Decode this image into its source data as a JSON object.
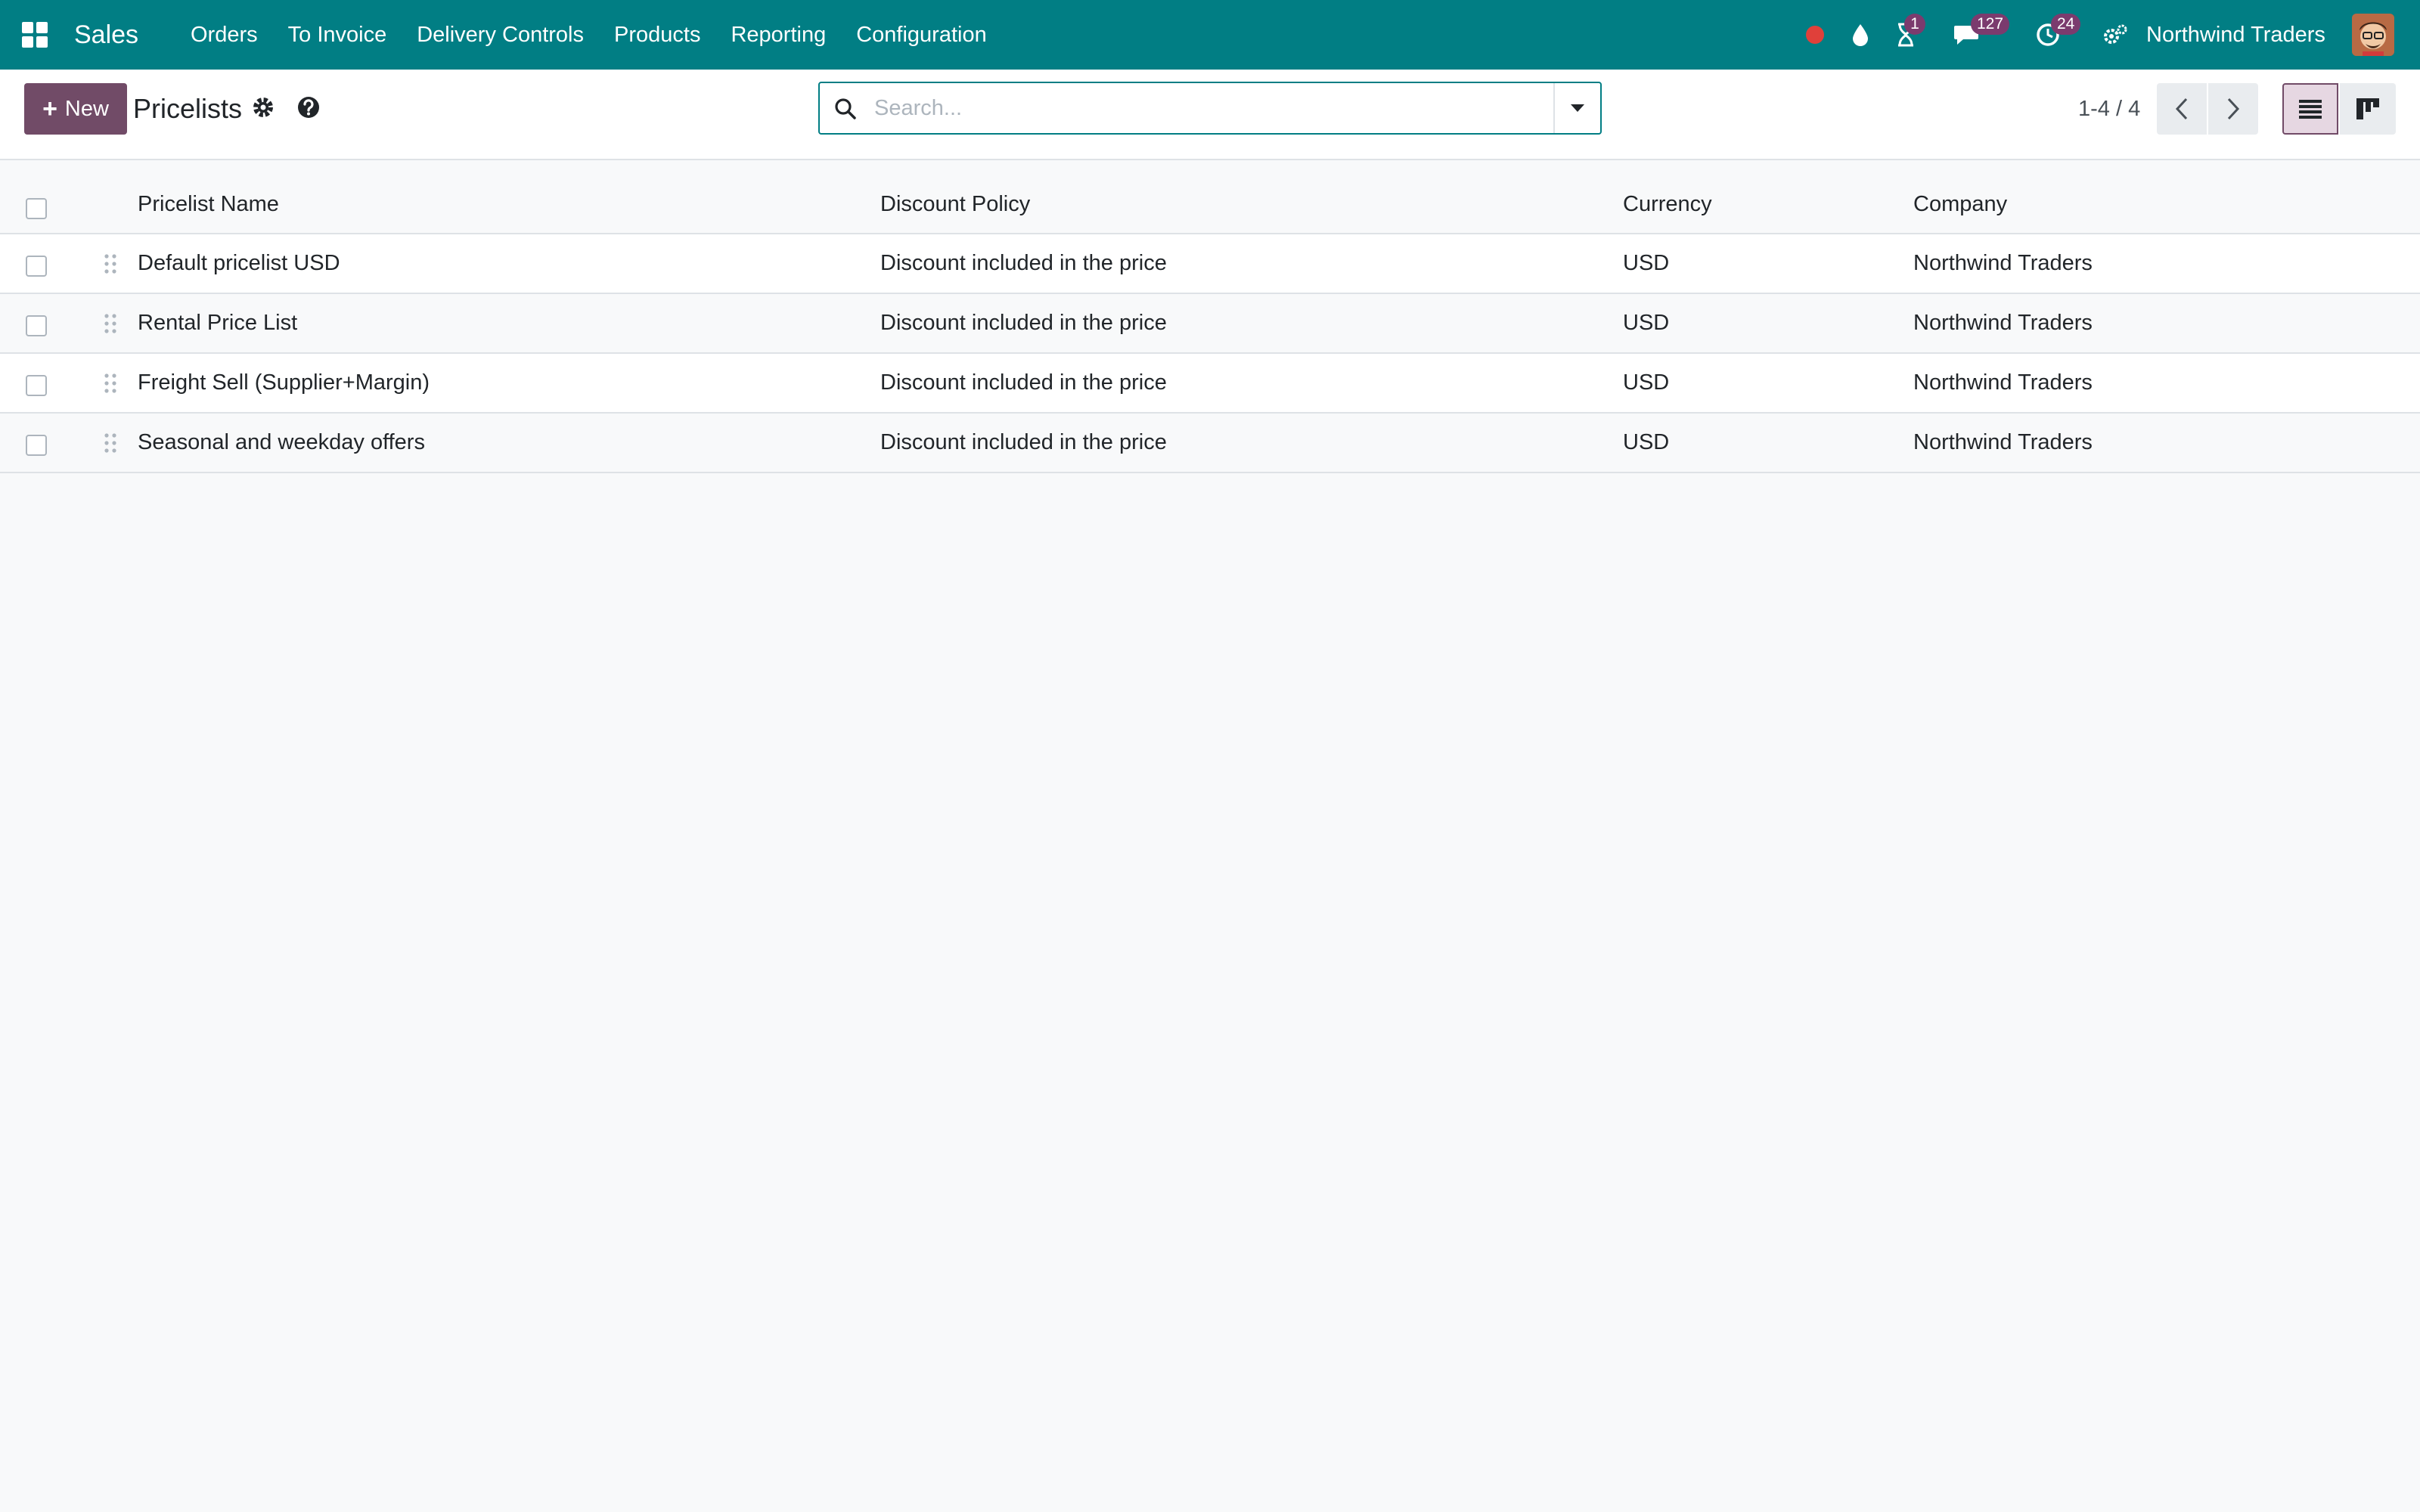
{
  "navbar": {
    "app_name": "Sales",
    "menu": [
      "Orders",
      "To Invoice",
      "Delivery Controls",
      "Products",
      "Reporting",
      "Configuration"
    ],
    "badges": {
      "activities": "1",
      "messages": "127",
      "clock": "24"
    },
    "company": "Northwind Traders"
  },
  "control_panel": {
    "new_label": "New",
    "title": "Pricelists",
    "search_placeholder": "Search...",
    "pager": "1-4 / 4"
  },
  "table": {
    "headers": {
      "name": "Pricelist Name",
      "policy": "Discount Policy",
      "currency": "Currency",
      "company": "Company"
    },
    "rows": [
      {
        "name": "Default pricelist USD",
        "policy": "Discount included in the price",
        "currency": "USD",
        "company": "Northwind Traders"
      },
      {
        "name": "Rental Price List",
        "policy": "Discount included in the price",
        "currency": "USD",
        "company": "Northwind Traders"
      },
      {
        "name": "Freight Sell (Supplier+Margin)",
        "policy": "Discount included in the price",
        "currency": "USD",
        "company": "Northwind Traders"
      },
      {
        "name": "Seasonal and weekday offers",
        "policy": "Discount included in the price",
        "currency": "USD",
        "company": "Northwind Traders"
      }
    ]
  },
  "icons": {
    "apps": "apps-grid-icon",
    "record": "record-icon",
    "drop": "drop-icon",
    "hourglass": "hourglass-icon",
    "chat": "chat-icon",
    "clock": "clock-icon",
    "settings": "settings-icon",
    "cog": "cog-icon",
    "help": "help-icon",
    "search": "search-icon",
    "caret": "caret-down-icon",
    "prev": "chevron-left-icon",
    "next": "chevron-right-icon",
    "list": "list-view-icon",
    "kanban": "kanban-view-icon",
    "drag": "drag-handle-icon"
  },
  "colors": {
    "navbar": "#017e84",
    "primary": "#714b67",
    "badge": "#7b3b6e",
    "record": "#e0403a"
  }
}
